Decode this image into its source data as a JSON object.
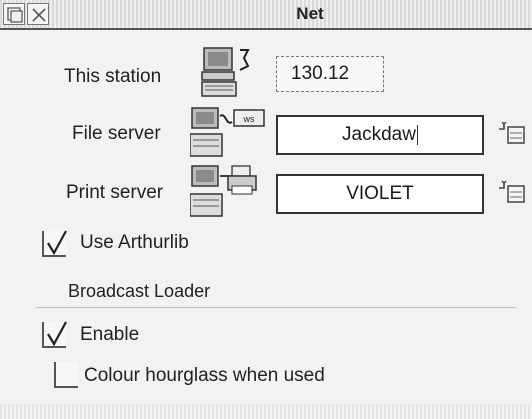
{
  "window": {
    "title": "Net"
  },
  "station": {
    "label": "This station",
    "value": "130.12"
  },
  "file_server": {
    "label": "File server",
    "value": "Jackdaw",
    "icon_badge": "ws"
  },
  "print_server": {
    "label": "Print server",
    "value": "VIOLET"
  },
  "options": {
    "use_arthurlib": {
      "label": "Use Arthurlib",
      "checked": true
    },
    "broadcast_loader": {
      "heading": "Broadcast Loader",
      "enable": {
        "label": "Enable",
        "checked": true
      },
      "colour_hourglass": {
        "label": "Colour hourglass when used",
        "checked": false
      }
    }
  },
  "icons": {
    "close": "close-icon",
    "back": "back-icon",
    "station": "station-computer-icon",
    "file_server": "file-server-icon",
    "print_server": "print-server-icon",
    "popup": "popup-menu-icon"
  }
}
